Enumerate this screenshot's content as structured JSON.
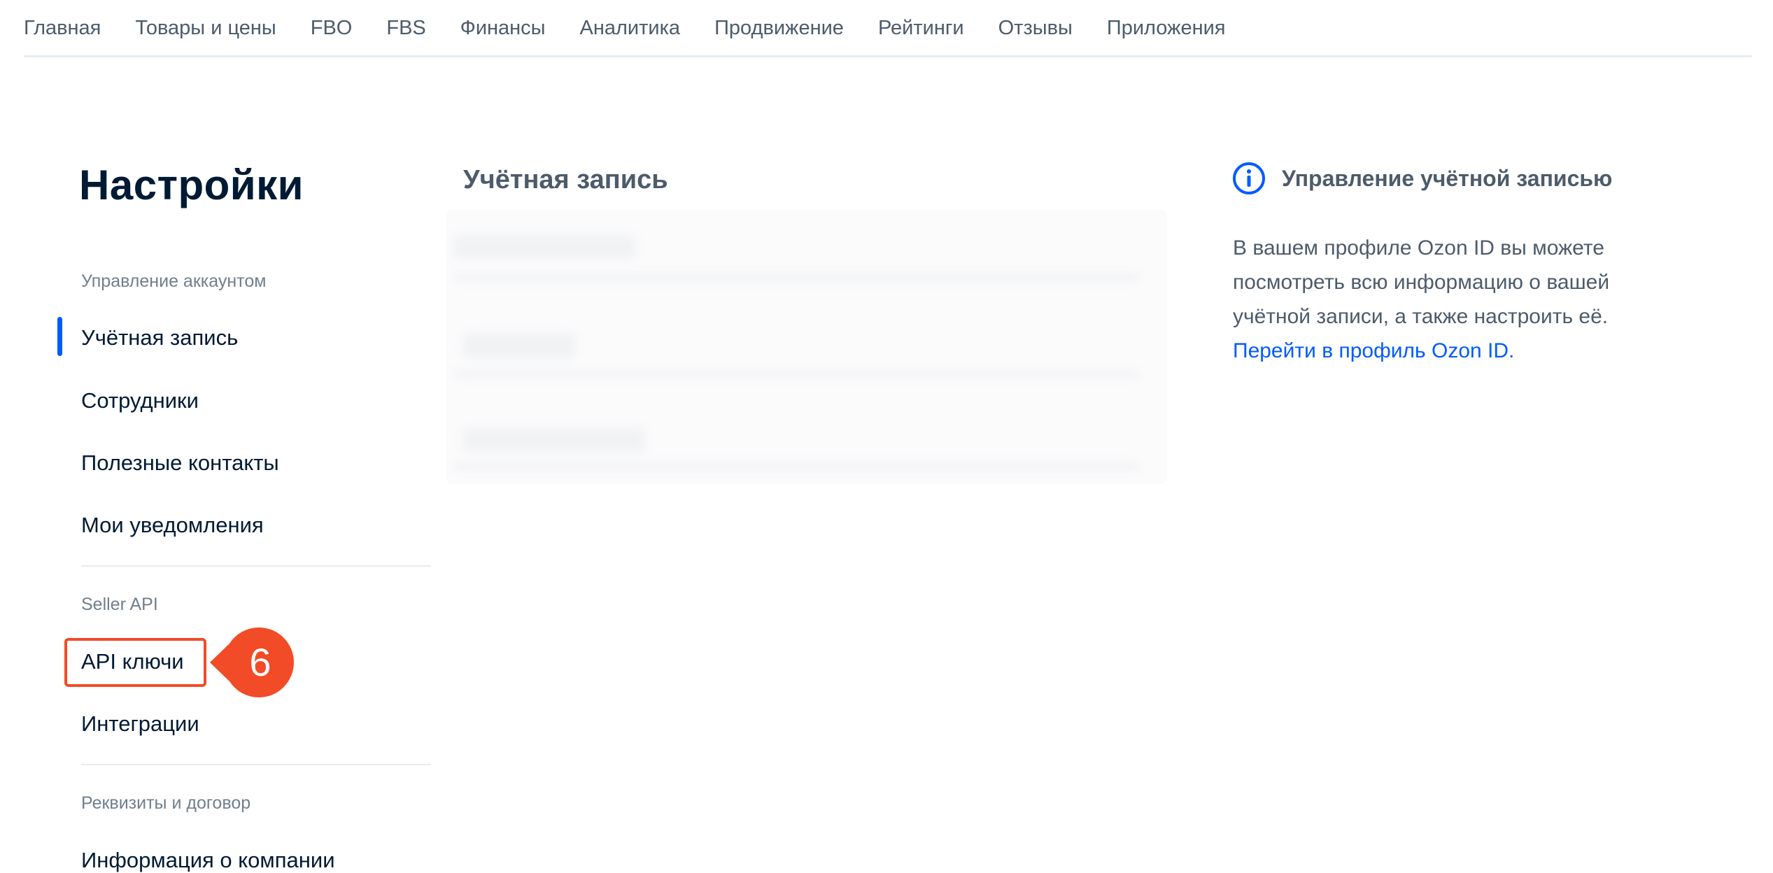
{
  "topnav": {
    "items": [
      "Главная",
      "Товары и цены",
      "FBO",
      "FBS",
      "Финансы",
      "Аналитика",
      "Продвижение",
      "Рейтинги",
      "Отзывы",
      "Приложения"
    ]
  },
  "sidebar": {
    "title": "Настройки",
    "sections": [
      {
        "label": "Управление аккаунтом",
        "items": [
          "Учётная запись",
          "Сотрудники",
          "Полезные контакты",
          "Мои уведомления"
        ]
      },
      {
        "label": "Seller API",
        "items": [
          "API ключи",
          "Интеграции"
        ]
      },
      {
        "label": "Реквизиты и договор",
        "items": [
          "Информация о компании"
        ]
      }
    ],
    "active_item": "Учётная запись",
    "callout_number": "6"
  },
  "main": {
    "section_title": "Учётная запись"
  },
  "info_panel": {
    "icon": "info-icon",
    "title": "Управление учётной записью",
    "text_lines": [
      "В вашем профиле Ozon ID вы можете",
      "посмотреть всю информацию о вашей",
      "учётной записи, а также настроить её."
    ],
    "link": "Перейти в профиль Ozon ID."
  },
  "colors": {
    "accent": "#005bff",
    "callout": "#f24b27",
    "text_primary": "#001a34",
    "text_secondary": "#4d5b6b"
  }
}
